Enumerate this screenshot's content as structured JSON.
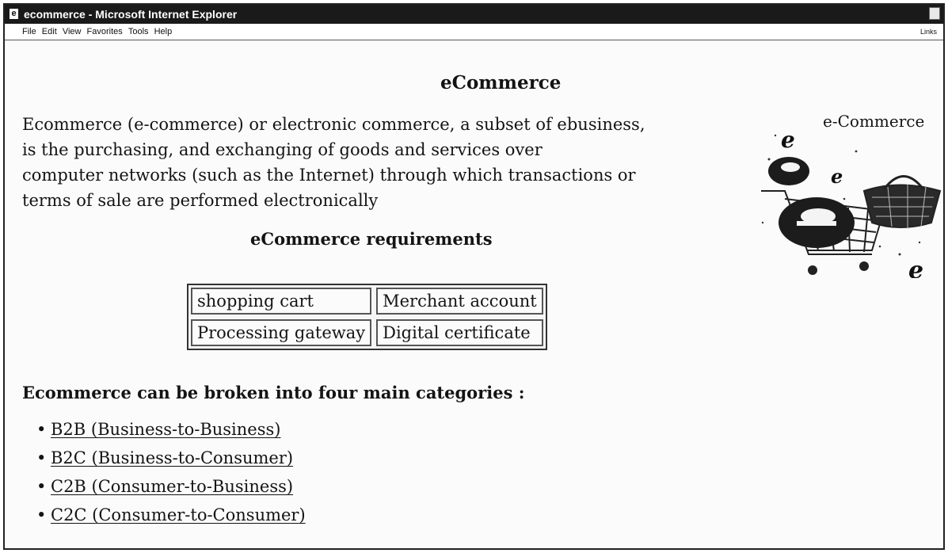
{
  "window": {
    "title": "ecommerce - Microsoft Internet Explorer",
    "app_icon_glyph": "e"
  },
  "menubar": {
    "items": [
      "File",
      "Edit",
      "View",
      "Favorites",
      "Tools",
      "Help"
    ],
    "links_label": "Links"
  },
  "page": {
    "title": "eCommerce",
    "intro_lines": [
      "Ecommerce (e-commerce) or electronic commerce, a subset of ebusiness,",
      "is the purchasing, and exchanging of goods and services over",
      "computer networks (such as the Internet) through which transactions or",
      "terms of sale are performed electronically"
    ],
    "graphic_label": "e-Commerce",
    "graphic_icon": "shopping-cart-with-e-logos",
    "requirements_title": "eCommerce requirements",
    "requirements": [
      [
        "shopping cart",
        "Merchant account"
      ],
      [
        "Processing gateway",
        "Digital certificate"
      ]
    ],
    "categories_title": "Ecommerce can be broken into four main categories :",
    "categories": [
      "B2B (Business-to-Business)",
      "B2C (Business-to-Consumer)",
      "C2B (Consumer-to-Business)",
      "C2C (Consumer-to-Consumer)"
    ]
  }
}
